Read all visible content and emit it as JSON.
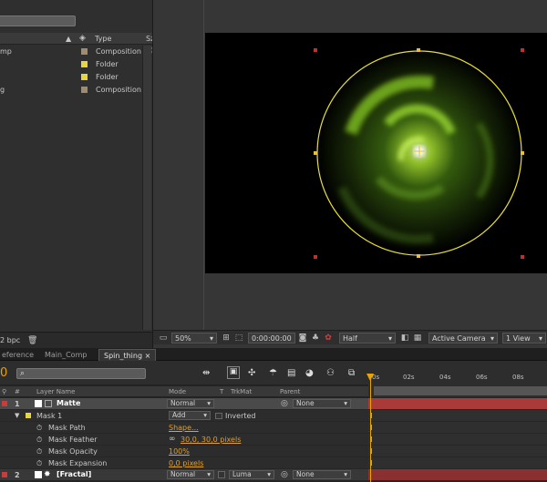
{
  "project_panel": {
    "type_header": "Type",
    "size_header": "Sz",
    "items": [
      {
        "name": "mp",
        "type": "Composition",
        "swatch": "#a08c6a"
      },
      {
        "name": "",
        "type": "Folder",
        "swatch": "#e8d440"
      },
      {
        "name": "",
        "type": "Folder",
        "swatch": "#e8d440"
      },
      {
        "name": "g",
        "type": "Composition",
        "swatch": "#a08c6a"
      }
    ],
    "bpc": "2 bpc"
  },
  "viewer": {
    "zoom": "50%",
    "timecode": "0:00:00:00",
    "resolution": "Half",
    "camera": "Active Camera",
    "view": "1 View"
  },
  "timeline": {
    "tabs": [
      {
        "label": "eference",
        "active": false
      },
      {
        "label": "Main_Comp",
        "active": false
      },
      {
        "label": "Spin_thing",
        "active": true
      }
    ],
    "current_time": "0",
    "columns": {
      "num": "#",
      "layer_name": "Layer Name",
      "mode": "Mode",
      "t": "T",
      "trkmat": "TrkMat",
      "parent": "Parent"
    },
    "ruler_ticks": [
      "0s",
      "02s",
      "04s",
      "06s",
      "08s"
    ],
    "layers": [
      {
        "num": "1",
        "name": "Matte",
        "mode": "Normal",
        "parent": "None",
        "label_color": "#c83c3c"
      },
      {
        "num": "2",
        "name": "[Fractal]",
        "mode": "Normal",
        "trkmat": "Luma",
        "parent": "None",
        "label_color": "#c83c3c"
      }
    ],
    "mask": {
      "name": "Mask 1",
      "mode": "Add",
      "inverted_label": "Inverted",
      "properties": [
        {
          "name": "Mask Path",
          "value": "Shape..."
        },
        {
          "name": "Mask Feather",
          "value": "30,0, 30,0 pixels"
        },
        {
          "name": "Mask Opacity",
          "value": "100%"
        },
        {
          "name": "Mask Expansion",
          "value": "0,0 pixels"
        }
      ]
    }
  },
  "colors": {
    "accent": "#e8a400",
    "mask_path": "#e8e030",
    "glow": "#8ed020"
  }
}
